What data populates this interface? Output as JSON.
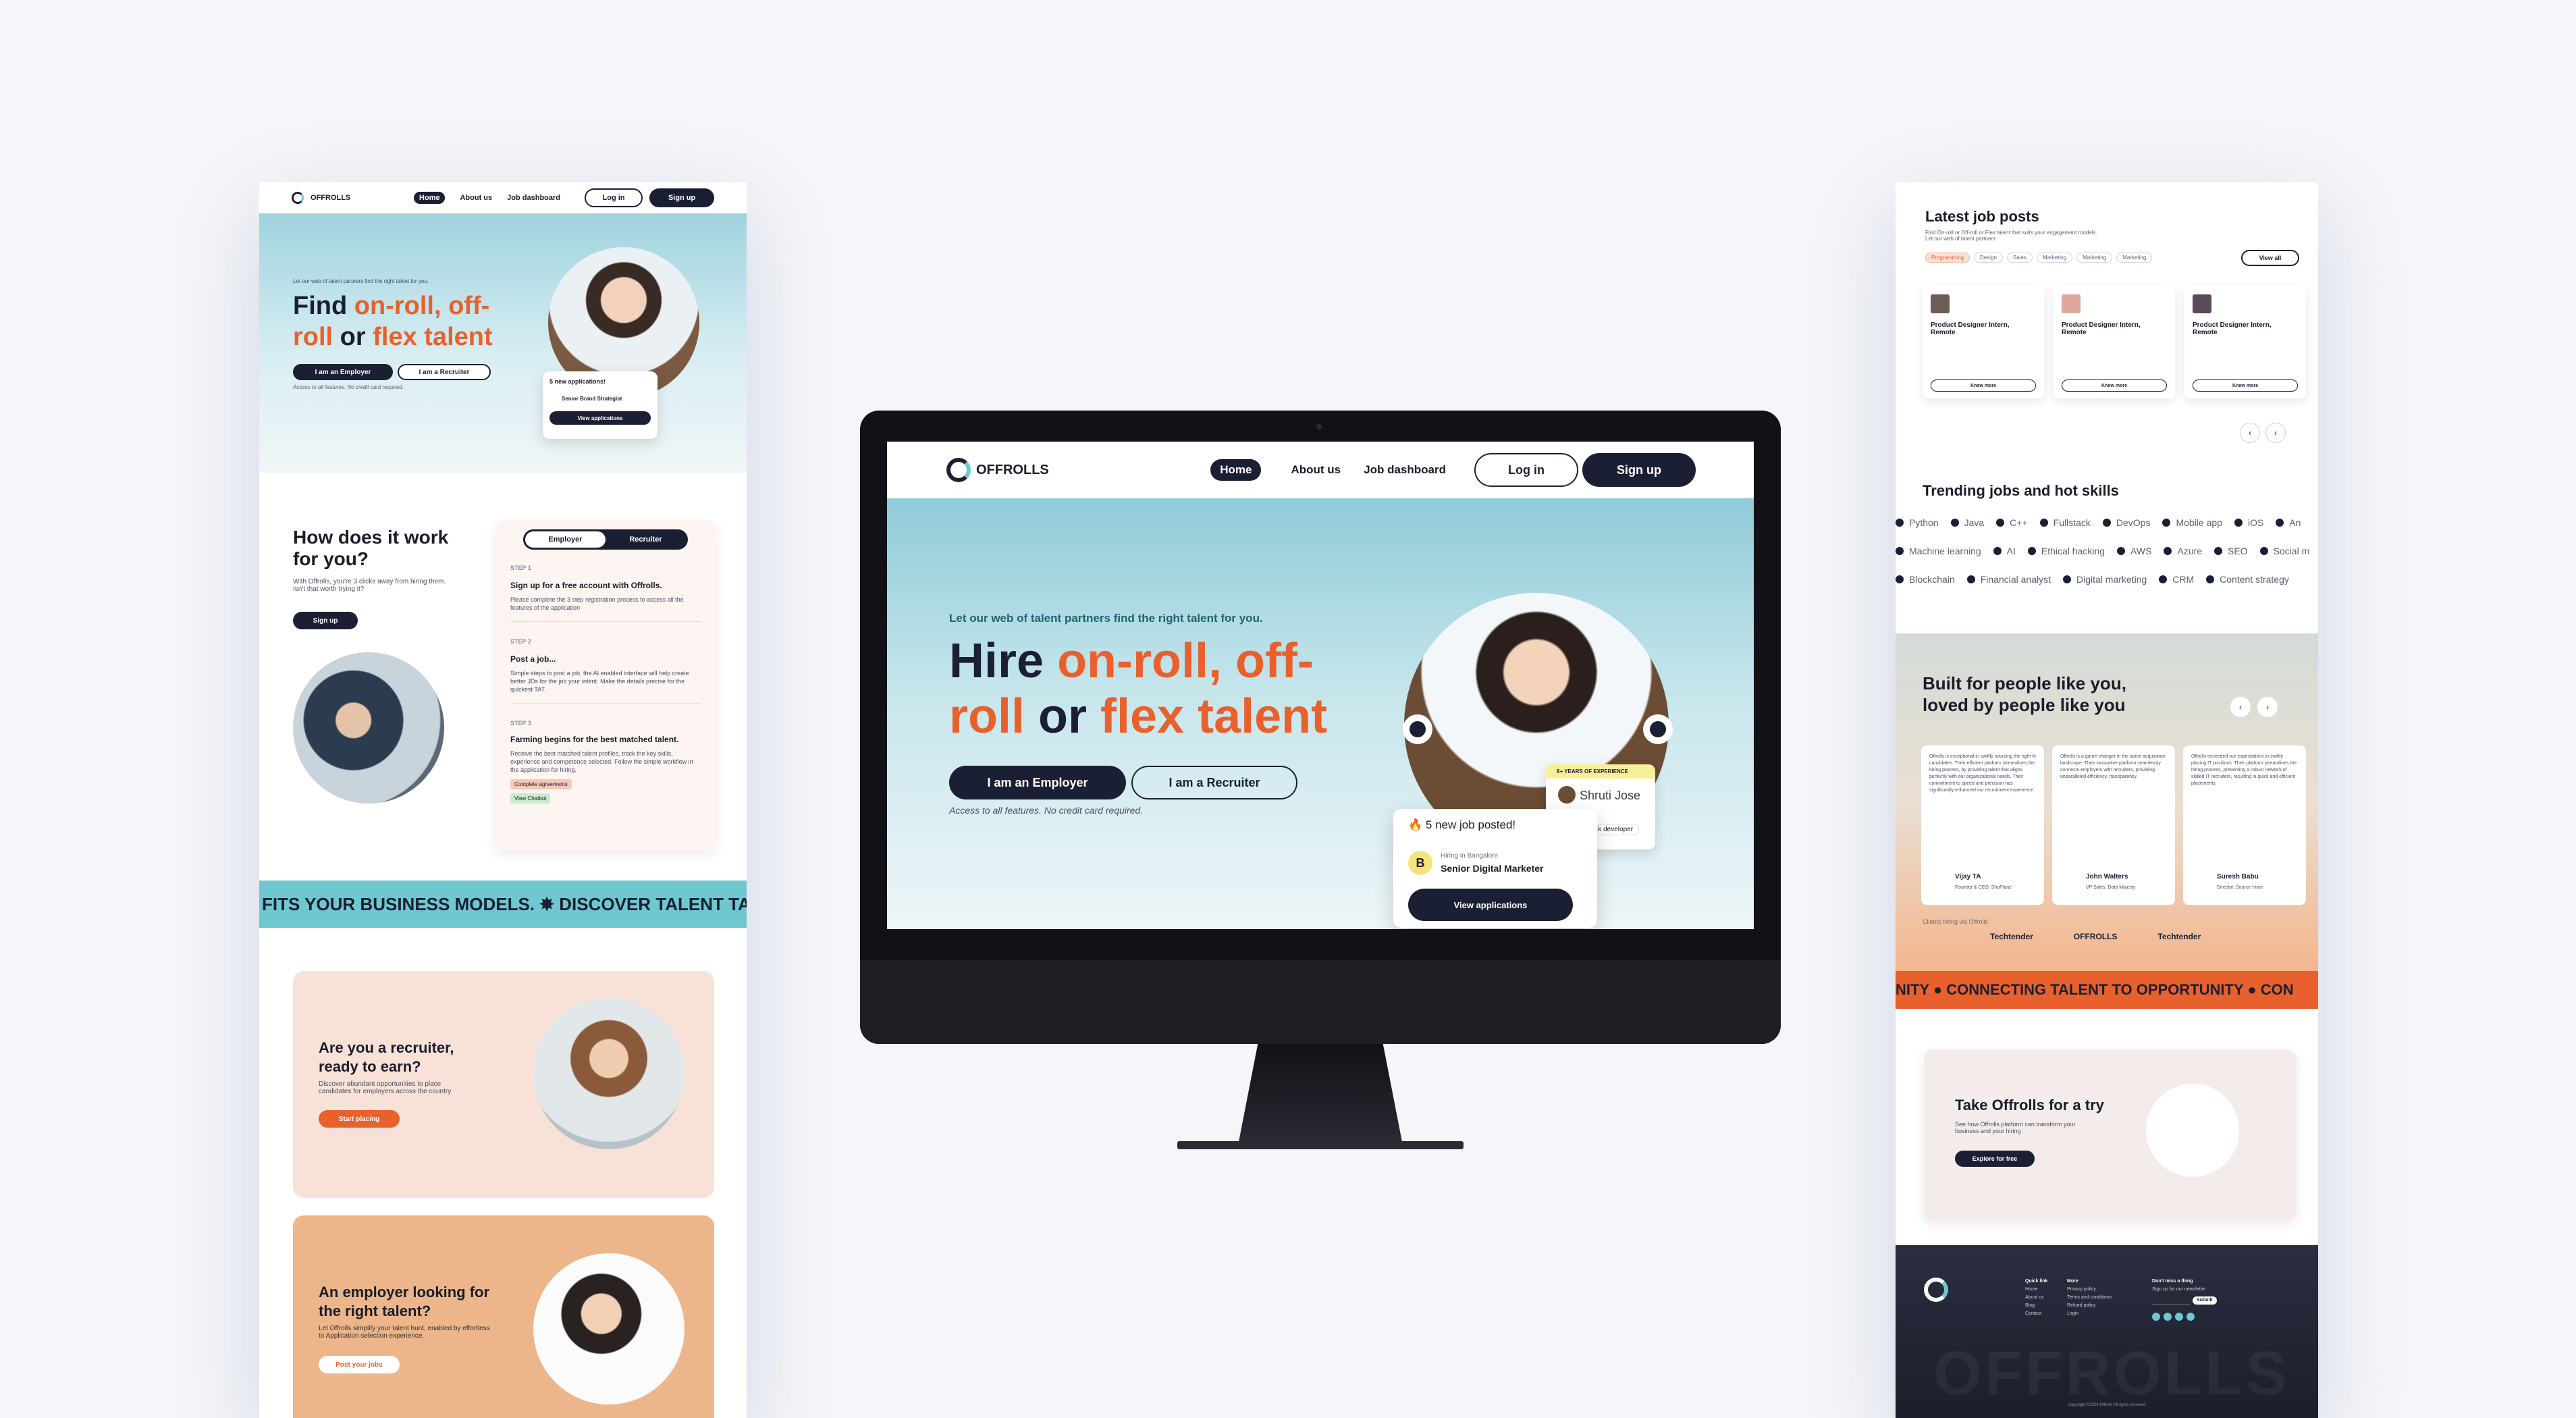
{
  "brand": {
    "name": "OFFROLLS"
  },
  "nav": {
    "home": "Home",
    "about": "About us",
    "dashboard": "Job dashboard",
    "login": "Log in",
    "signup": "Sign up"
  },
  "hero": {
    "tagline": "Let our web of talent partners find the right talent for you.",
    "headline_1": "Hire ",
    "headline_hl1": "on-roll, off-",
    "headline_hl2": "roll",
    "headline_2": " or ",
    "headline_hl3": "flex talent",
    "btn_employer": "I am an Employer",
    "btn_recruiter": "I am a Recruiter",
    "note": "Access to all features. No credit card required.",
    "badge_exp": "8+ YEARS OF EXPERIENCE",
    "person_name": "Shruti Jose",
    "person_role": "...k developer",
    "notif_title": "🔥 5 new job posted!",
    "notif_sub": "Hiring in Bangalore",
    "notif_job": "Senior Digital Marketer",
    "notif_letter": "B",
    "notif_btn": "View applications"
  },
  "left_panel": {
    "tagline": "Let our web of talent partners find the right talent for you.",
    "headline_1": "Find ",
    "headline_hl1": "on-roll, off-",
    "headline_hl2": "roll",
    "headline_2": " or ",
    "headline_hl3": "flex talent",
    "notif_title": "5 new applications!",
    "notif_job": "Senior Brand Strategist",
    "how_title": "How does it work for you?",
    "how_text": "With Offrolls, you're 3 clicks away from hiring them. Isn't that worth trying it?",
    "toggle_employer": "Employer",
    "toggle_recruiter": "Recruiter",
    "steps": [
      {
        "label": "STEP 1",
        "title": "Sign up for a free account with Offrolls.",
        "text": "Please complete the 3 step registration process to access all the features of the application"
      },
      {
        "label": "STEP 2",
        "title": "Post a job...",
        "text": "Simple steps to post a job, the AI enabled interface will help create better JDs for the job your intent. Make the details precise for the quickest TAT."
      },
      {
        "label": "STEP 3",
        "title": "Farming begins for the best matched talent.",
        "text": "Receive the best matched talent profiles, track the key skills, experience and competence selected. Follow the simple workflow in the application for hiring."
      }
    ],
    "tag_complete": "Complete agreements",
    "tag_view": "View Chatbot",
    "marquee": "FITS YOUR BUSINESS MODELS. ✸ DISCOVER TALENT TAILORED TO Y",
    "recruiter_title": "Are you a recruiter, ready to earn?",
    "recruiter_text": "Discover abundant opportunities to place candidates for employers across the country",
    "recruiter_btn": "Start placing",
    "employer_title": "An employer looking for the right talent?",
    "employer_text": "Let Offrolls simplify your talent hunt, enabled by effortless to Application selection experience.",
    "employer_btn": "Post your jobs"
  },
  "right_panel": {
    "jobs_title": "Latest job posts",
    "jobs_sub": "Find On-roll or Off-roll or Flex talent that suits your engagement models. Let our web of talent partners",
    "filters": [
      "Programming",
      "Design",
      "Sales",
      "Marketing",
      "Marketing",
      "Marketing"
    ],
    "view_all": "View all",
    "job_cards": [
      {
        "title": "Product Designer Intern, Remote",
        "btn": "Know more"
      },
      {
        "title": "Product Designer Intern, Remote",
        "btn": "Know more"
      },
      {
        "title": "Product Designer Intern, Remote",
        "btn": "Know more"
      }
    ],
    "trending_title": "Trending jobs and hot skills",
    "skills_row1": [
      "Python",
      "Java",
      "C++",
      "Fullstack",
      "DevOps",
      "Mobile app",
      "iOS",
      "An"
    ],
    "skills_row2": [
      "Machine learning",
      "AI",
      "Ethical hacking",
      "AWS",
      "Azure",
      "SEO",
      "Social m"
    ],
    "skills_row3": [
      "Blockchain",
      "Financial analyst",
      "Digital marketing",
      "CRM",
      "Content strategy",
      ""
    ],
    "built_title": "Built for people like you, loved by people like you",
    "testimonials": [
      {
        "text": "Offrolls is exceptional in swiftly sourcing the right fit candidates. Their efficient platform streamlines the hiring process, by providing talent that aligns perfectly with our organizational needs. Their commitment to speed and precision has significantly enhanced our recruitment experience.",
        "name": "Vijay TA",
        "role": "Founder & CEO, ShoPlanz"
      },
      {
        "text": "Offrolls is a game-changer in the talent acquisition landscape. Their innovative platform seamlessly connects employers with recruiters, providing unparalleled efficiency, transparency.",
        "name": "John Walters",
        "role": "VP Sales, Data Majesty"
      },
      {
        "text": "Offrolls exceeded our expectations in swiftly placing IT positions. Their platform streamlines the hiring process, presenting a robust network of skilled IT recruiters, resulting in quick and efficient placements.",
        "name": "Suresh Babu",
        "role": "Director, Source Hiver"
      }
    ],
    "clients_label": "Clients hiring via Offrolls",
    "clients": [
      "Techtender",
      "OFFROLLS",
      "Techtender"
    ],
    "marquee": "NITY ● CONNECTING TALENT TO OPPORTUNITY ● CON",
    "try_title": "Take Offrolls for a try",
    "try_text": "See how Offrolls platform can transform your business and your hiring",
    "try_btn": "Explore for free",
    "footer_cols": [
      {
        "title": "Quick link",
        "items": [
          "Home",
          "About us",
          "Blog",
          "Contact"
        ]
      },
      {
        "title": "More",
        "items": [
          "Privacy policy",
          "Terms and conditions",
          "Refund policy",
          "Login"
        ]
      },
      {
        "title": "Don't miss a thing",
        "items": [
          "Sign up for our newsletter"
        ]
      }
    ],
    "subscribe_btn": "Submit",
    "footer_big": "OFFROLLS",
    "copyright": "Copyright ©2024 Offrolls All rights reserved"
  },
  "colors": {
    "accent": "#e8612c",
    "dark": "#1b1f33",
    "teal": "#6fc7cf"
  }
}
